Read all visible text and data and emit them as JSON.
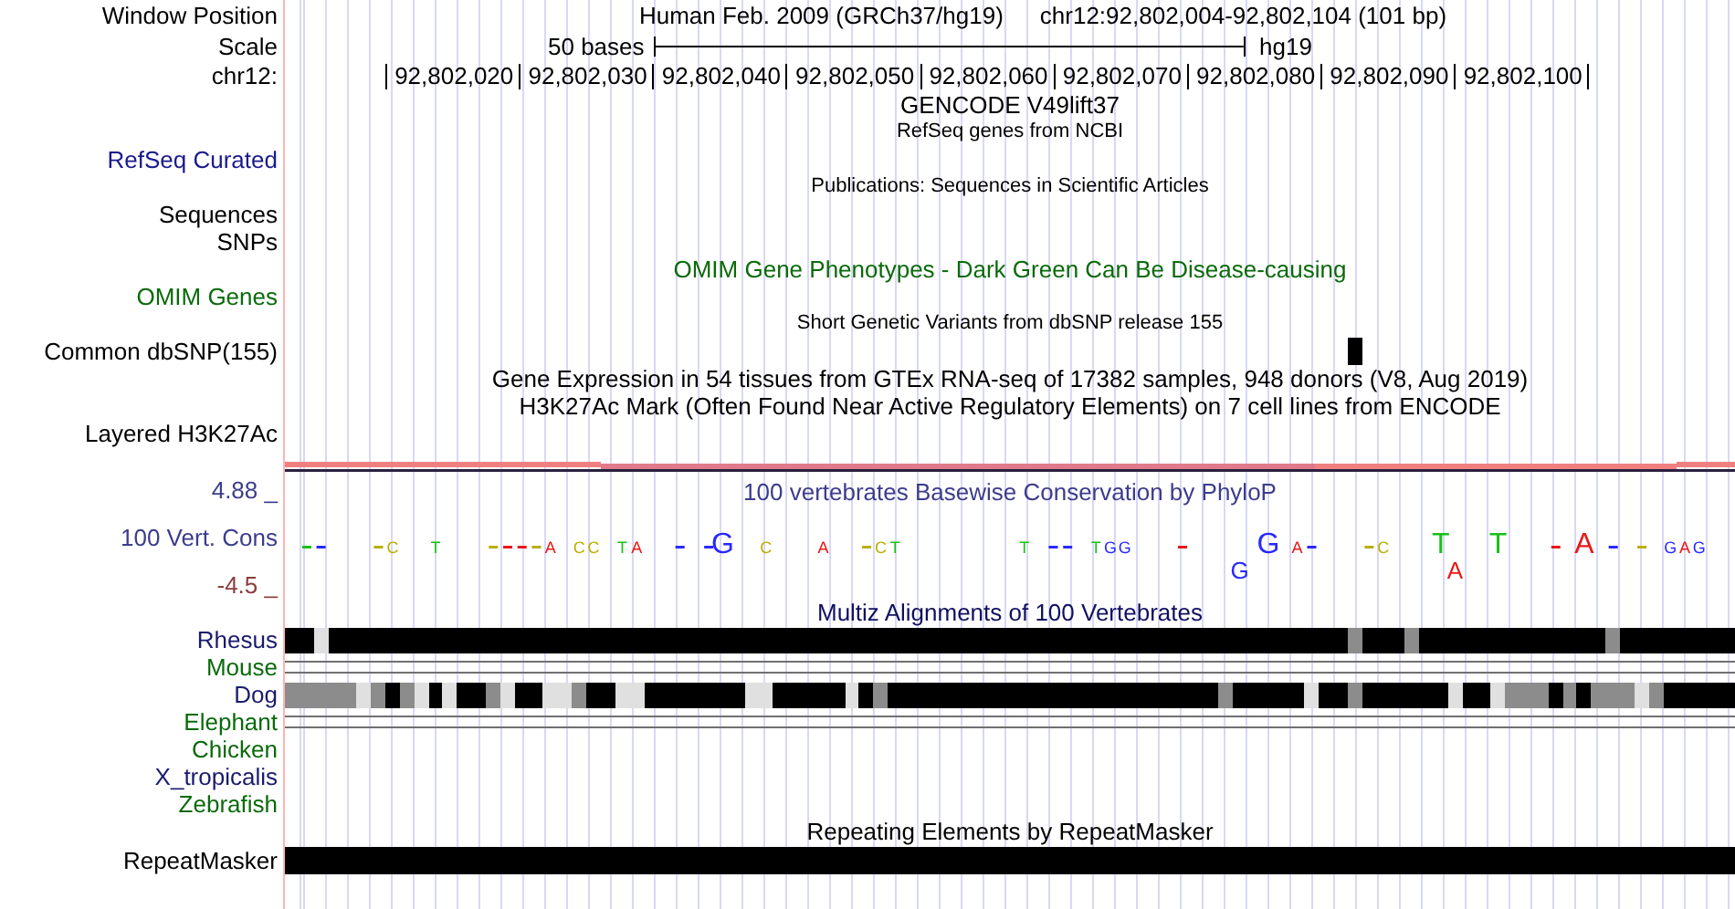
{
  "header": {
    "label": "Window Position",
    "assembly": "Human Feb. 2009 (GRCh37/hg19)",
    "position": "chr12:92,802,004-92,802,104 (101 bp)"
  },
  "scale": {
    "label": "Scale",
    "length": "50 bases",
    "db": "hg19"
  },
  "ruler": {
    "label": "chr12:",
    "ticks": [
      "92,802,020",
      "92,802,030",
      "92,802,040",
      "92,802,050",
      "92,802,060",
      "92,802,070",
      "92,802,080",
      "92,802,090",
      "92,802,100"
    ]
  },
  "tracks": [
    {
      "kind": "caption",
      "text": "GENCODE V49lift37",
      "color": "#000000"
    },
    {
      "kind": "note",
      "text": "RefSeq genes from NCBI",
      "color": "#000000"
    },
    {
      "kind": "label",
      "label": "RefSeq Curated",
      "color": "#1a1a8c"
    },
    {
      "kind": "note",
      "text": "Publications: Sequences in Scientific Articles",
      "color": "#000000"
    },
    {
      "kind": "label",
      "label": "Sequences",
      "color": "#000000"
    },
    {
      "kind": "label",
      "label": "SNPs",
      "color": "#000000"
    },
    {
      "kind": "caption",
      "text": "OMIM Gene Phenotypes - Dark Green Can Be Disease-causing",
      "color": "#0a6a0a"
    },
    {
      "kind": "label",
      "label": "OMIM Genes",
      "color": "#0a6a0a"
    },
    {
      "kind": "note",
      "text": "Short Genetic Variants from dbSNP release 155",
      "color": "#000000"
    },
    {
      "kind": "variants",
      "label": "Common dbSNP(155)",
      "color": "#000000"
    },
    {
      "kind": "caption",
      "text": "Gene Expression in 54 tissues from GTEx RNA-seq of 17382 samples, 948 donors (V8, Aug 2019)",
      "color": "#000000"
    },
    {
      "kind": "caption",
      "text": "H3K27Ac Mark (Often Found Near Active Regulatory Elements) on 7 cell lines from ENCODE",
      "color": "#000000"
    },
    {
      "kind": "label",
      "label": "Layered H3K27Ac",
      "color": "#000000"
    },
    {
      "kind": "signal"
    },
    {
      "kind": "conservation",
      "title": "100 vertebrates Basewise Conservation by PhyloP",
      "max": "4.88 _",
      "label": "100 Vert. Cons",
      "min": "-4.5 _",
      "color": "#3c3c8c",
      "logo": [
        {
          "kind": "small",
          "base": "C"
        },
        {
          "kind": "small",
          "base": "T"
        },
        {
          "kind": "small",
          "base": "A"
        },
        {
          "kind": "small",
          "base": "C"
        },
        {
          "kind": "small",
          "base": "C"
        },
        {
          "kind": "small",
          "base": "T"
        },
        {
          "kind": "small",
          "base": "A"
        },
        {
          "kind": "large",
          "base": "G"
        },
        {
          "kind": "small",
          "base": "C"
        },
        {
          "kind": "small",
          "base": "A"
        },
        {
          "kind": "small",
          "base": "C"
        },
        {
          "kind": "small",
          "base": "T"
        },
        {
          "kind": "small",
          "base": "T"
        },
        {
          "kind": "small",
          "base": "T"
        },
        {
          "kind": "small",
          "base": "G"
        },
        {
          "kind": "small",
          "base": "G"
        },
        {
          "kind": "below",
          "base": "G"
        },
        {
          "kind": "large",
          "base": "G"
        },
        {
          "kind": "small",
          "base": "A"
        },
        {
          "kind": "small",
          "base": "C"
        },
        {
          "kind": "large",
          "base": "T"
        },
        {
          "kind": "below",
          "base": "A"
        },
        {
          "kind": "large",
          "base": "T"
        },
        {
          "kind": "large",
          "base": "A"
        },
        {
          "kind": "small",
          "base": "G"
        },
        {
          "kind": "small",
          "base": "A"
        },
        {
          "kind": "small",
          "base": "G"
        }
      ]
    },
    {
      "kind": "caption",
      "text": "Multiz Alignments of 100 Vertebrates",
      "color": "#101060"
    },
    {
      "kind": "alignment",
      "label": "Rhesus",
      "color": "#1a1a6e"
    },
    {
      "kind": "gap",
      "label": "Mouse",
      "color": "#0a6a0a"
    },
    {
      "kind": "alignment",
      "label": "Dog",
      "color": "#1a1a6e"
    },
    {
      "kind": "gap",
      "label": "Elephant",
      "color": "#0a6a0a"
    },
    {
      "kind": "label",
      "label": "Chicken",
      "color": "#0a6a0a"
    },
    {
      "kind": "label",
      "label": "X_tropicalis",
      "color": "#1a1a6e"
    },
    {
      "kind": "label",
      "label": "Zebrafish",
      "color": "#0a6a0a"
    },
    {
      "kind": "caption",
      "text": "Repeating Elements by RepeatMasker",
      "color": "#000000"
    },
    {
      "kind": "repeat",
      "label": "RepeatMasker",
      "color": "#000000"
    }
  ]
}
